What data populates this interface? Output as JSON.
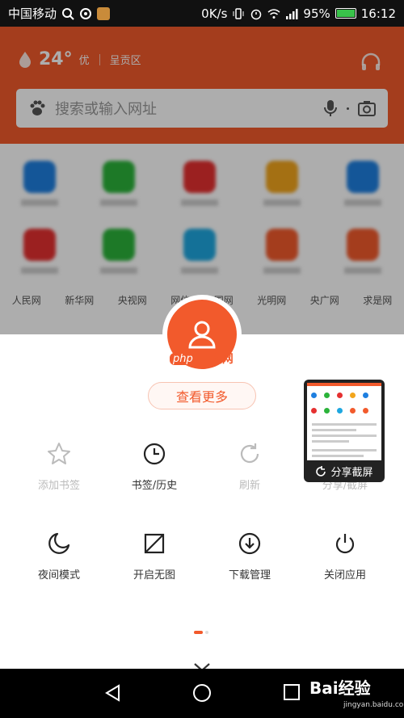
{
  "status_bar": {
    "carrier": "中国移动",
    "net_speed": "0K/s",
    "battery": "95%",
    "time": "16:12"
  },
  "header": {
    "temperature": "24°",
    "air_quality": "优",
    "region": "呈贡区",
    "search_placeholder": "搜索或输入网址"
  },
  "background_links": [
    "人民网",
    "新华网",
    "央视网",
    "网信",
    "国网",
    "光明网",
    "央广网",
    "求是网"
  ],
  "watermark": {
    "php": "php",
    "cn": "中文网"
  },
  "more_button": "查看更多",
  "menu_row1": [
    {
      "label": "添加书签",
      "icon": "star-icon",
      "disabled": true
    },
    {
      "label": "书签/历史",
      "icon": "clock-icon",
      "disabled": false
    },
    {
      "label": "刷新",
      "icon": "refresh-icon",
      "disabled": true
    },
    {
      "label": "分享/截屏",
      "icon": "share-icon",
      "disabled": true
    }
  ],
  "menu_row2": [
    {
      "label": "夜间模式",
      "icon": "moon-icon",
      "disabled": false
    },
    {
      "label": "开启无图",
      "icon": "no-image-icon",
      "disabled": false
    },
    {
      "label": "下载管理",
      "icon": "download-icon",
      "disabled": false
    },
    {
      "label": "关闭应用",
      "icon": "power-icon",
      "disabled": false
    }
  ],
  "screenshot_preview": {
    "label": "分享截屏"
  },
  "pager": {
    "pages": 2,
    "current": 1
  },
  "nav": {
    "brand": "Bai经验",
    "brand_sub": "jingyan.baidu.com"
  },
  "colors": {
    "accent": "#f25a2c",
    "dim": "rgba(0,0,0,0.32)"
  }
}
